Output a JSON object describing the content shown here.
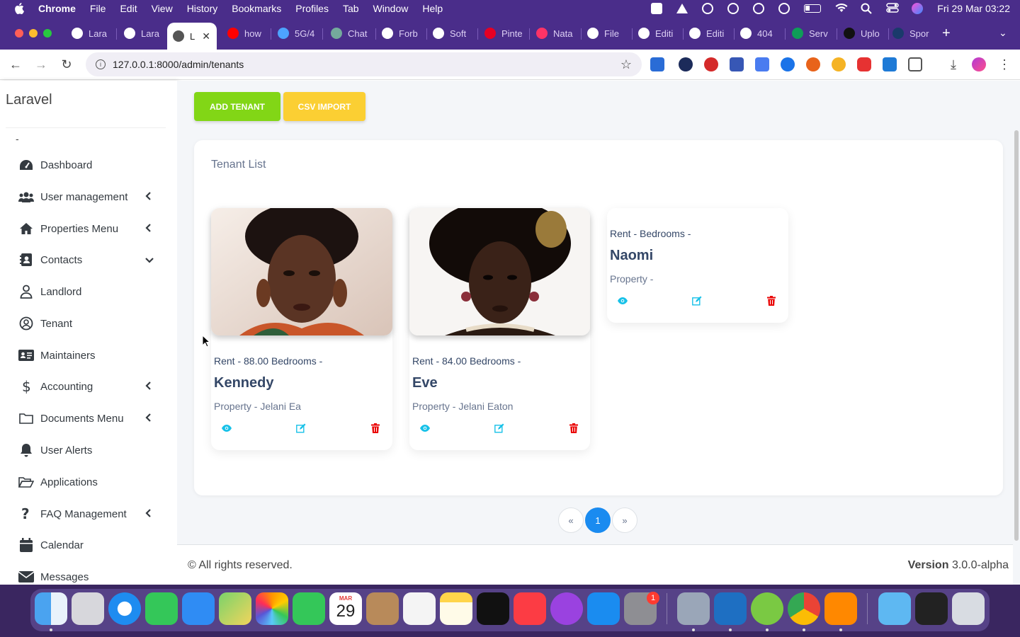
{
  "menubar": {
    "app": "Chrome",
    "items": [
      "File",
      "Edit",
      "View",
      "History",
      "Bookmarks",
      "Profiles",
      "Tab",
      "Window",
      "Help"
    ],
    "clock": "Fri 29 Mar  03:22"
  },
  "tabs": [
    {
      "label": "Lara",
      "color": "#ffffff"
    },
    {
      "label": "Lara",
      "color": "#ffffff"
    },
    {
      "label": "L",
      "color": "#555555",
      "active": true
    },
    {
      "label": "how",
      "color": "#ff0000"
    },
    {
      "label": "5G/4",
      "color": "#4da3ff"
    },
    {
      "label": "Chat",
      "color": "#74aa9c"
    },
    {
      "label": "Forb",
      "color": "#ffffff"
    },
    {
      "label": "Soft",
      "color": "#ffffff"
    },
    {
      "label": "Pinte",
      "color": "#e60023"
    },
    {
      "label": "Nata",
      "color": "#ff3366"
    },
    {
      "label": "File",
      "color": "#ffffff"
    },
    {
      "label": "Editi",
      "color": "#ffffff"
    },
    {
      "label": "Editi",
      "color": "#ffffff"
    },
    {
      "label": "404",
      "color": "#ffffff"
    },
    {
      "label": "Serv",
      "color": "#0f9d58"
    },
    {
      "label": "Uplo",
      "color": "#111111"
    },
    {
      "label": "Spor",
      "color": "#1a3a6b"
    }
  ],
  "address": {
    "url": "127.0.0.1:8000/admin/tenants"
  },
  "sidebar": {
    "brand": "Laravel",
    "user": "-",
    "items": [
      {
        "label": "Dashboard",
        "icon": "dashboard-icon",
        "arrow": ""
      },
      {
        "label": "User management",
        "icon": "users-icon",
        "arrow": "‹"
      },
      {
        "label": "Properties Menu",
        "icon": "home-icon",
        "arrow": "‹"
      },
      {
        "label": "Contacts",
        "icon": "contacts-icon",
        "arrow": "⌄"
      },
      {
        "label": "Landlord",
        "icon": "user-icon",
        "arrow": ""
      },
      {
        "label": "Tenant",
        "icon": "user-circle-icon",
        "arrow": ""
      },
      {
        "label": "Maintainers",
        "icon": "id-card-icon",
        "arrow": ""
      },
      {
        "label": "Accounting",
        "icon": "dollar-icon",
        "arrow": "‹"
      },
      {
        "label": "Documents Menu",
        "icon": "folder-icon",
        "arrow": "‹"
      },
      {
        "label": "User Alerts",
        "icon": "bell-icon",
        "arrow": ""
      },
      {
        "label": "Applications",
        "icon": "folder-open-icon",
        "arrow": ""
      },
      {
        "label": "FAQ Management",
        "icon": "question-icon",
        "arrow": "‹"
      },
      {
        "label": "Calendar",
        "icon": "calendar-icon",
        "arrow": ""
      },
      {
        "label": "Messages",
        "icon": "envelope-icon",
        "arrow": ""
      }
    ]
  },
  "actions": {
    "add": "ADD TENANT",
    "csv": "CSV IMPORT"
  },
  "list": {
    "title": "Tenant List",
    "tenants": [
      {
        "rent": "Rent - 88.00 Bedrooms -",
        "name": "Kennedy",
        "property": "Property - Jelani Ea",
        "has_photo": true
      },
      {
        "rent": "Rent - 84.00 Bedrooms -",
        "name": "Eve",
        "property": "Property - Jelani Eaton",
        "has_photo": true
      },
      {
        "rent": "Rent - Bedrooms -",
        "name": "Naomi",
        "property": "Property -",
        "has_photo": false
      }
    ]
  },
  "pagination": {
    "prev": "«",
    "current": "1",
    "next": "»"
  },
  "footer": {
    "copyright": "© All rights reserved.",
    "version_label": "Version",
    "version": "3.0.0-alpha"
  },
  "dock": {
    "calendar_month": "MAR",
    "calendar_day": "29",
    "settings_badge": "1"
  },
  "colors": {
    "add_button": "#82d616",
    "csv_button": "#fbcf33",
    "view_icon": "#17c1e8",
    "edit_icon": "#17c1e8",
    "delete_icon": "#ea0606",
    "page_active": "#1a8bf0",
    "browser_frame": "#4a2d8a"
  }
}
